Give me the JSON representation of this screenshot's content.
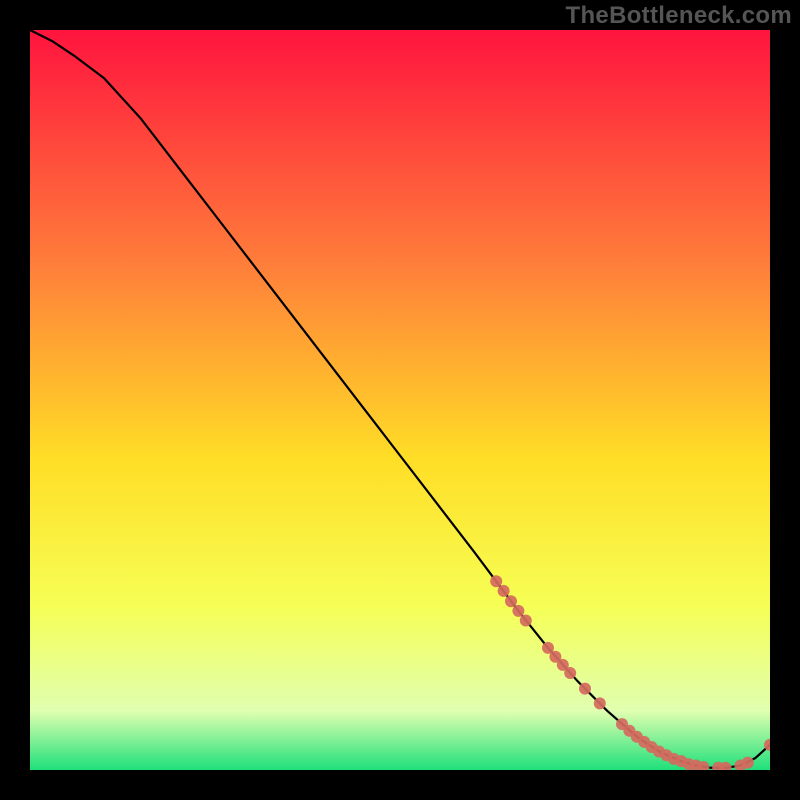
{
  "watermark": "TheBottleneck.com",
  "chart_data": {
    "type": "line",
    "title": "",
    "xlabel": "",
    "ylabel": "",
    "xlim": [
      0,
      100
    ],
    "ylim": [
      0,
      100
    ],
    "grid": false,
    "legend": false,
    "background_gradient": {
      "top_color": "#ff143e",
      "mid_upper_color": "#ff7f3a",
      "mid_color": "#ffde26",
      "mid_lower_color": "#f6ff56",
      "lower_color": "#e0ffb0",
      "bottom_color": "#1fe07b"
    },
    "series": [
      {
        "name": "bottleneck-curve",
        "color": "#000000",
        "x": [
          0,
          3,
          6,
          10,
          15,
          20,
          25,
          30,
          35,
          40,
          45,
          50,
          55,
          60,
          63,
          66,
          70,
          74,
          78,
          82,
          85,
          88,
          90,
          92,
          94,
          96,
          98,
          100
        ],
        "y": [
          100,
          98.5,
          96.5,
          93.5,
          88,
          81.5,
          75,
          68.5,
          62,
          55.5,
          49,
          42.5,
          36,
          29.5,
          25.5,
          21.5,
          16.5,
          12,
          8,
          4.5,
          2.5,
          1.2,
          0.6,
          0.3,
          0.3,
          0.6,
          1.6,
          3.4
        ]
      }
    ],
    "markers": {
      "name": "highlight-points",
      "color": "#d46a5e",
      "radius": 6,
      "points": [
        {
          "x": 63,
          "y": 25.5
        },
        {
          "x": 64,
          "y": 24.2
        },
        {
          "x": 65,
          "y": 22.8
        },
        {
          "x": 66,
          "y": 21.5
        },
        {
          "x": 67,
          "y": 20.2
        },
        {
          "x": 70,
          "y": 16.5
        },
        {
          "x": 71,
          "y": 15.3
        },
        {
          "x": 72,
          "y": 14.2
        },
        {
          "x": 73,
          "y": 13.1
        },
        {
          "x": 75,
          "y": 11.0
        },
        {
          "x": 77,
          "y": 9.0
        },
        {
          "x": 80,
          "y": 6.2
        },
        {
          "x": 81,
          "y": 5.3
        },
        {
          "x": 82,
          "y": 4.5
        },
        {
          "x": 83,
          "y": 3.8
        },
        {
          "x": 84,
          "y": 3.1
        },
        {
          "x": 85,
          "y": 2.5
        },
        {
          "x": 86,
          "y": 2.0
        },
        {
          "x": 87,
          "y": 1.5
        },
        {
          "x": 88,
          "y": 1.2
        },
        {
          "x": 89,
          "y": 0.8
        },
        {
          "x": 90,
          "y": 0.6
        },
        {
          "x": 91,
          "y": 0.4
        },
        {
          "x": 93,
          "y": 0.3
        },
        {
          "x": 94,
          "y": 0.3
        },
        {
          "x": 96,
          "y": 0.6
        },
        {
          "x": 97,
          "y": 1.0
        },
        {
          "x": 100,
          "y": 3.4
        }
      ]
    }
  }
}
